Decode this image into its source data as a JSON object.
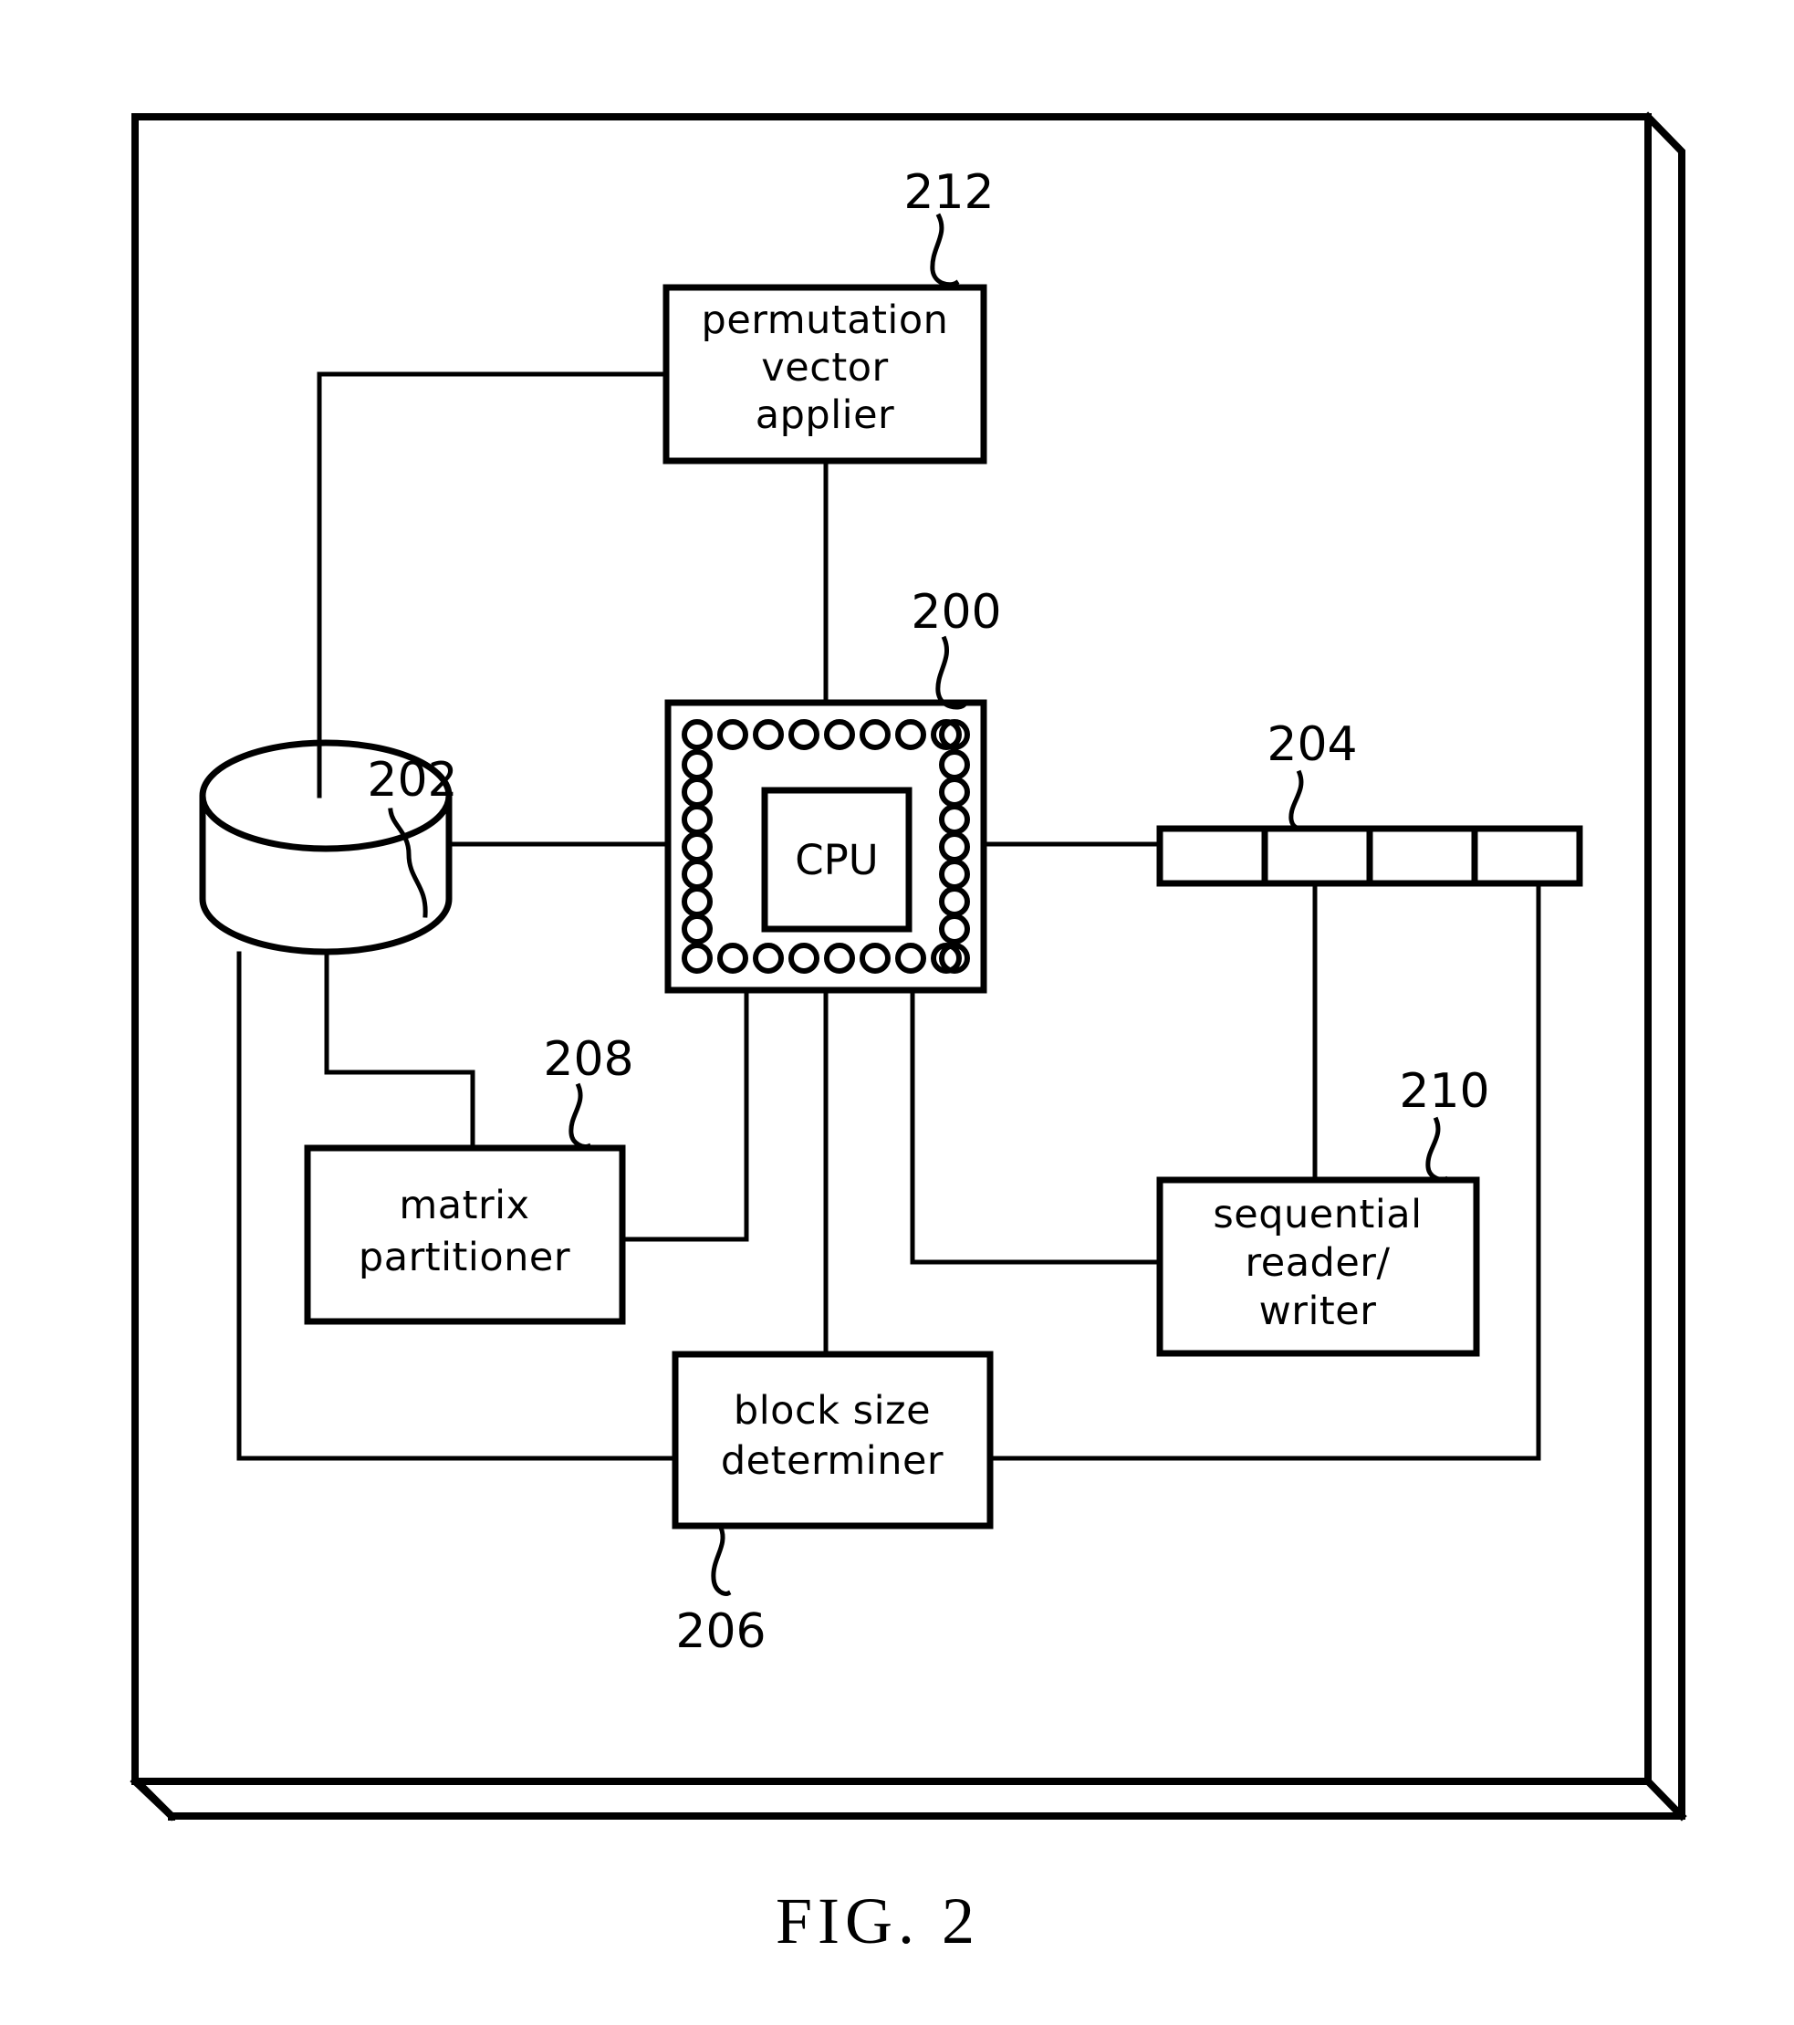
{
  "figure": {
    "caption": "FIG.  2",
    "title": "System block diagram"
  },
  "blocks": [
    {
      "id": "permutation-vector-applier",
      "ref": "212",
      "lines": [
        "permutation",
        "vector",
        "applier"
      ]
    },
    {
      "id": "processor-chip",
      "ref": "200",
      "lines": [
        "CPU"
      ]
    },
    {
      "id": "storage-cylinder",
      "ref": "202",
      "lines": []
    },
    {
      "id": "buffer-array",
      "ref": "204",
      "lines": [],
      "cells": [
        "",
        "",
        "",
        ""
      ]
    },
    {
      "id": "matrix-partitioner",
      "ref": "208",
      "lines": [
        "matrix",
        "partitioner"
      ]
    },
    {
      "id": "sequential-reader-writer",
      "ref": "210",
      "lines": [
        "sequential",
        "reader/",
        "writer"
      ]
    },
    {
      "id": "block-size-determiner",
      "ref": "206",
      "lines": [
        "block  size",
        "determiner"
      ]
    }
  ],
  "labels": {
    "permutation_l1": "permutation",
    "permutation_l2": "vector",
    "permutation_l3": "applier",
    "cpu": "CPU",
    "matrix_l1": "matrix",
    "matrix_l2": "partitioner",
    "seq_l1": "sequential",
    "seq_l2": "reader/",
    "seq_l3": "writer",
    "blocksize_l1": "block  size",
    "blocksize_l2": "determiner"
  },
  "refnums": {
    "chip": "200",
    "storage": "202",
    "buffer": "204",
    "block_size": "206",
    "partitioner": "208",
    "sequential": "210",
    "permutation": "212"
  },
  "colors": {
    "ink": "#000000",
    "paper": "#ffffff"
  }
}
